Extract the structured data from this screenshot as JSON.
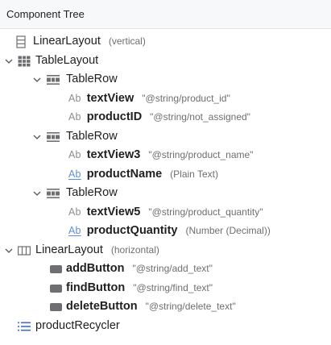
{
  "panel": {
    "title": "Component Tree"
  },
  "icon_map": {
    "linear-vertical-icon": "vertical linear layout (stacked rectangles)",
    "table-layout-icon": "grid",
    "table-row-icon": "bar rows",
    "textview-icon": "Ab",
    "edittext-icon": "Ab underlined",
    "linear-horizontal-icon": "horizontal linear layout (columns)",
    "button-icon": "rounded rectangle",
    "recyclerview-icon": "list lines"
  },
  "tree": {
    "root_layout": {
      "name": "LinearLayout",
      "attr": "(vertical)"
    },
    "table_layout": {
      "name": "TableLayout"
    },
    "row1": {
      "name": "TableRow",
      "child1": {
        "ab": "Ab",
        "name": "textView",
        "attr": "\"@string/product_id\""
      },
      "child2": {
        "ab": "Ab",
        "name": "productID",
        "attr": "\"@string/not_assigned\""
      }
    },
    "row2": {
      "name": "TableRow",
      "child1": {
        "ab": "Ab",
        "name": "textView3",
        "attr": "\"@string/product_name\""
      },
      "child2": {
        "ab": "Ab",
        "name": "productName",
        "attr": "(Plain Text)"
      }
    },
    "row3": {
      "name": "TableRow",
      "child1": {
        "ab": "Ab",
        "name": "textView5",
        "attr": "\"@string/product_quantity\""
      },
      "child2": {
        "ab": "Ab",
        "name": "productQuantity",
        "attr": "(Number (Decimal))"
      }
    },
    "button_layout": {
      "name": "LinearLayout",
      "attr": "(horizontal)"
    },
    "add_button": {
      "name": "addButton",
      "attr": "\"@string/add_text\""
    },
    "find_button": {
      "name": "findButton",
      "attr": "\"@string/find_text\""
    },
    "delete_button": {
      "name": "deleteButton",
      "attr": "\"@string/delete_text\""
    },
    "recycler": {
      "name": "productRecycler"
    }
  },
  "colors": {
    "icon_blue": "#3d6fc3",
    "icon_gray": "#6e6e73",
    "attr_gray": "#6e6e73",
    "header_bg": "#f7f8fa"
  }
}
